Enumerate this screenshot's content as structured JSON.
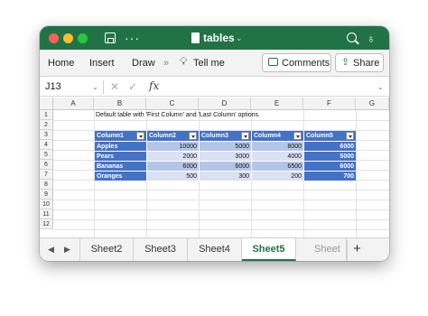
{
  "window": {
    "title": "tables",
    "title_chevron": "⌄",
    "more_glyph": "···"
  },
  "ribbon": {
    "tabs": [
      "Home",
      "Insert",
      "Draw"
    ],
    "overflow": "»",
    "tell_me": "Tell me",
    "comments_label": "Comments",
    "share_label": "Share"
  },
  "formula_bar": {
    "name_box": "J13",
    "name_chevron": "⌄",
    "cancel_glyph": "✕",
    "enter_glyph": "✓",
    "fx_label": "fx",
    "formula_value": "",
    "expand_chevron": "⌄"
  },
  "sheet": {
    "columns": [
      "A",
      "B",
      "C",
      "D",
      "E",
      "F",
      "G"
    ],
    "rows": [
      "1",
      "2",
      "3",
      "4",
      "5",
      "6",
      "7",
      "8",
      "9",
      "10",
      "11",
      "12"
    ],
    "description": "Default table with 'First Column' and 'Last Column' options.",
    "table": {
      "headers": [
        "Column1",
        "Column2",
        "Column3",
        "Column4",
        "Column5"
      ],
      "rows": [
        [
          "Apples",
          "10000",
          "5000",
          "8000",
          "6000"
        ],
        [
          "Pears",
          "2000",
          "3000",
          "4000",
          "5000"
        ],
        [
          "Bananas",
          "6000",
          "6000",
          "6500",
          "6000"
        ],
        [
          "Oranges",
          "500",
          "300",
          "200",
          "700"
        ]
      ]
    }
  },
  "sheet_tabs": {
    "prev_glyph": "◀",
    "next_glyph": "▶",
    "tabs": [
      "Sheet2",
      "Sheet3",
      "Sheet4",
      "Sheet5",
      "Sheet"
    ],
    "active": "Sheet5",
    "add_glyph": "+"
  },
  "colors": {
    "accent": "#217346",
    "table_header": "#4472c4",
    "band_dark": "#b4c6e7",
    "band_light": "#d9e1f2"
  }
}
